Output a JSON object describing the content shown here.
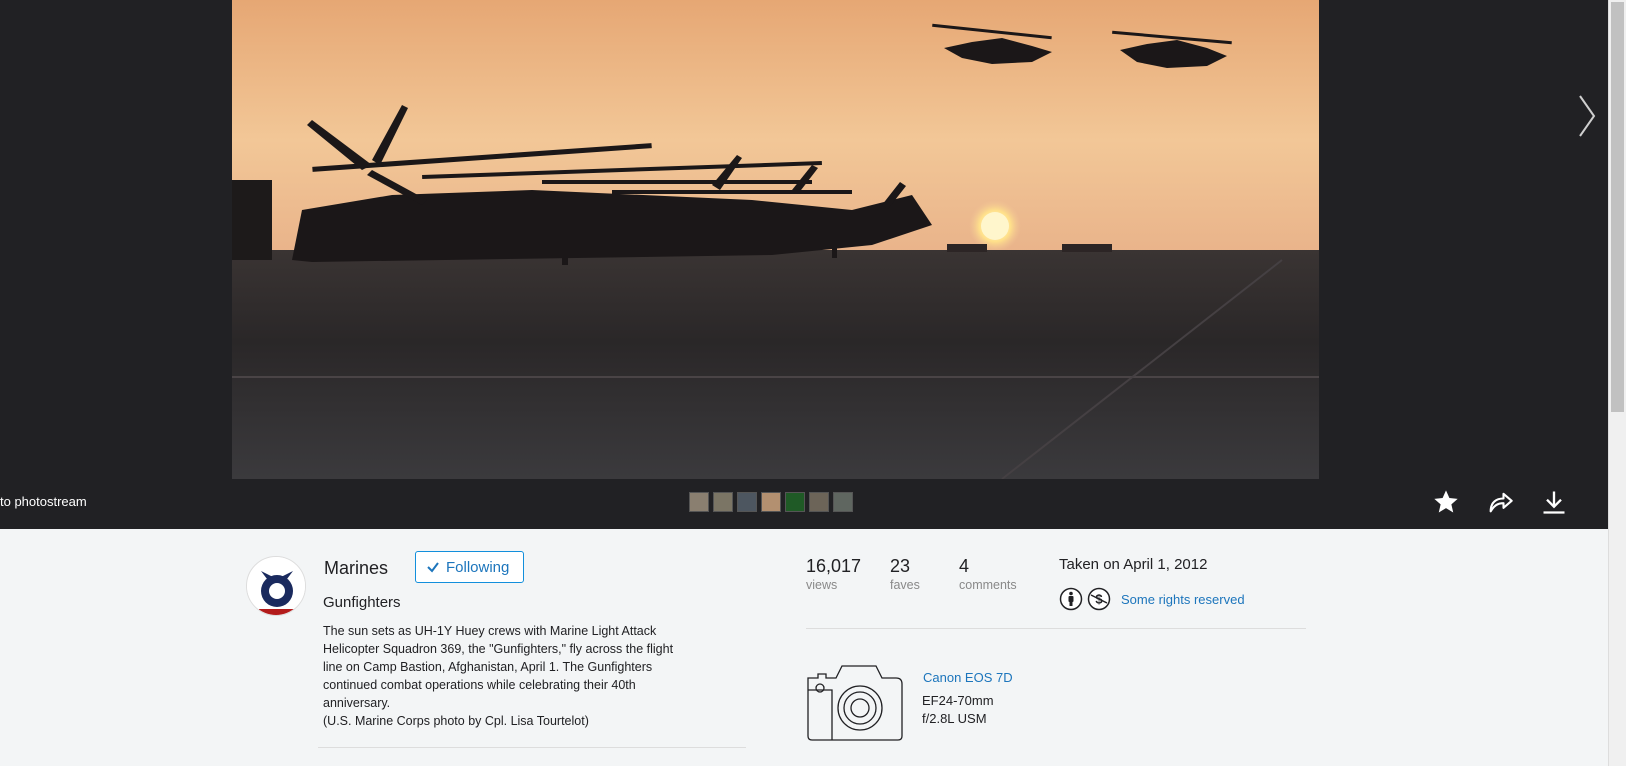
{
  "viewer": {
    "back_label": "to photostream",
    "actions": {
      "fave_icon": "star-icon",
      "share_icon": "share-icon",
      "download_icon": "download-icon"
    },
    "filmstrip_count": 7
  },
  "owner": {
    "name": "Marines",
    "follow_label": "Following"
  },
  "photo": {
    "title": "Gunfighters",
    "description_lines": [
      "The sun sets as UH-1Y Huey crews with Marine Light Attack",
      "Helicopter Squadron 369, the \"Gunfighters,\" fly across the flight",
      "line on Camp Bastion, Afghanistan, April 1. The Gunfighters",
      "continued combat operations while celebrating their 40th",
      "anniversary.",
      "(U.S. Marine Corps photo by Cpl. Lisa Tourtelot)"
    ]
  },
  "stats": {
    "views_num": "16,017",
    "views_label": "views",
    "faves_num": "23",
    "faves_label": "faves",
    "comments_num": "4",
    "comments_label": "comments",
    "taken": "Taken on April 1, 2012",
    "license_label": "Some rights reserved"
  },
  "camera": {
    "model": "Canon EOS 7D",
    "lens_line1": "EF24-70mm",
    "lens_line2": "f/2.8L USM"
  },
  "colors": {
    "accent": "#1c75bc",
    "viewer_bg": "#212124",
    "page_bg": "#f3f5f6"
  }
}
